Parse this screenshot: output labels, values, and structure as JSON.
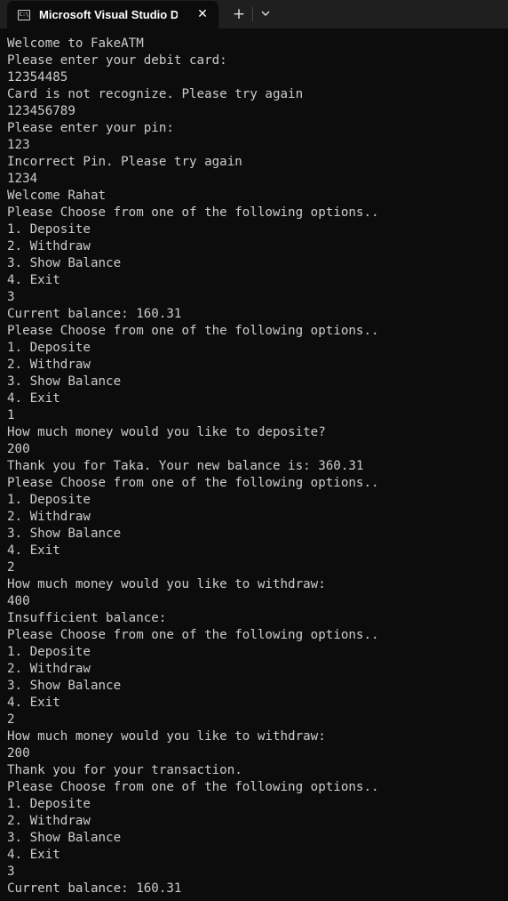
{
  "window": {
    "tab_title": "Microsoft Visual Studio Debug Console",
    "tab_icon_glyph": "C:\\",
    "close_glyph": "✕",
    "new_tab_glyph": "+",
    "dropdown_icon": "chevron-down-icon"
  },
  "console": {
    "lines": [
      "Welcome to FakeATM",
      "Please enter your debit card:",
      "12354485",
      "Card is not recognize. Please try again",
      "123456789",
      "Please enter your pin:",
      "123",
      "Incorrect Pin. Please try again",
      "1234",
      "Welcome Rahat",
      "Please Choose from one of the following options..",
      "1. Deposite",
      "2. Withdraw",
      "3. Show Balance",
      "4. Exit",
      "3",
      "Current balance: 160.31",
      "Please Choose from one of the following options..",
      "1. Deposite",
      "2. Withdraw",
      "3. Show Balance",
      "4. Exit",
      "1",
      "How much money would you like to deposite?",
      "200",
      "Thank you for Taka. Your new balance is: 360.31",
      "Please Choose from one of the following options..",
      "1. Deposite",
      "2. Withdraw",
      "3. Show Balance",
      "4. Exit",
      "2",
      "How much money would you like to withdraw:",
      "400",
      "Insufficient balance:",
      "Please Choose from one of the following options..",
      "1. Deposite",
      "2. Withdraw",
      "3. Show Balance",
      "4. Exit",
      "2",
      "How much money would you like to withdraw:",
      "200",
      "Thank you for your transaction.",
      "Please Choose from one of the following options..",
      "1. Deposite",
      "2. Withdraw",
      "3. Show Balance",
      "4. Exit",
      "3",
      "Current balance: 160.31"
    ]
  },
  "colors": {
    "background": "#0c0c0c",
    "titlebar": "#1f1f1f",
    "text": "#cccccc"
  }
}
